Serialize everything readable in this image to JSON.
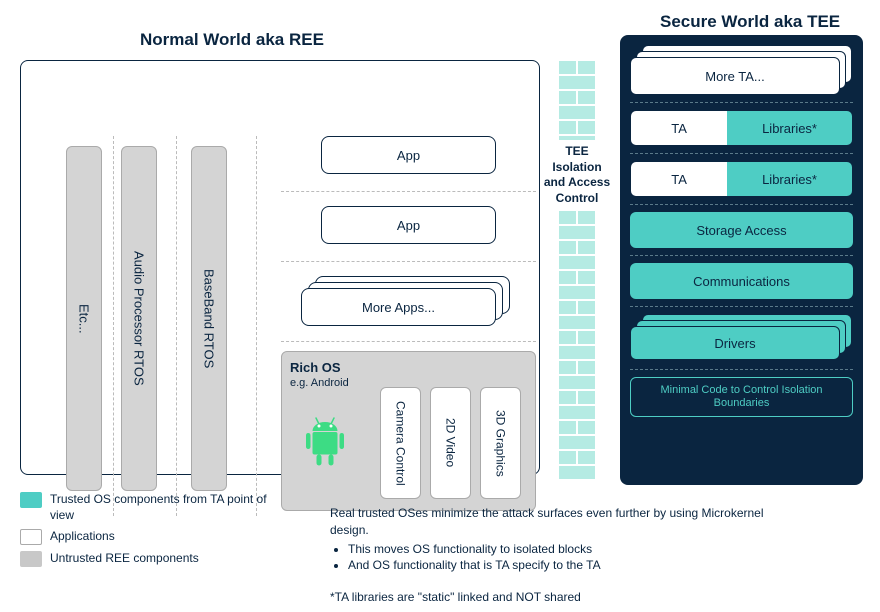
{
  "titles": {
    "ree": "Normal World aka REE",
    "tee": "Secure World aka TEE"
  },
  "ree": {
    "vertical_cols": {
      "etc": "Etc...",
      "audio": "Audio Processor RTOS",
      "baseband": "BaseBand RTOS"
    },
    "apps": {
      "app1": "App",
      "app2": "App",
      "more": "More Apps..."
    },
    "richos": {
      "label": "Rich OS",
      "sub": "e.g. Android",
      "cols": {
        "camera": "Camera Control",
        "video2d": "2D Video",
        "graphics3d": "3D Graphics"
      }
    }
  },
  "isolation": {
    "label": "TEE Isolation and Access Control"
  },
  "tee": {
    "more_ta": "More TA...",
    "ta_row": {
      "ta": "TA",
      "lib": "Libraries*"
    },
    "storage": "Storage Access",
    "comms": "Communications",
    "drivers": "Drivers",
    "minimal": "Minimal Code to Control Isolation Boundaries"
  },
  "legend": {
    "teal": "Trusted OS components from TA point of view",
    "white": "Applications",
    "gray": "Untrusted REE components"
  },
  "notes": {
    "intro": "Real trusted OSes minimize the attack surfaces even further by using Microkernel design.",
    "b1": "This moves OS functionality to isolated blocks",
    "b2": "And OS functionality that is TA specify to the TA",
    "footnote": "*TA libraries are \"static\" linked and NOT shared"
  }
}
